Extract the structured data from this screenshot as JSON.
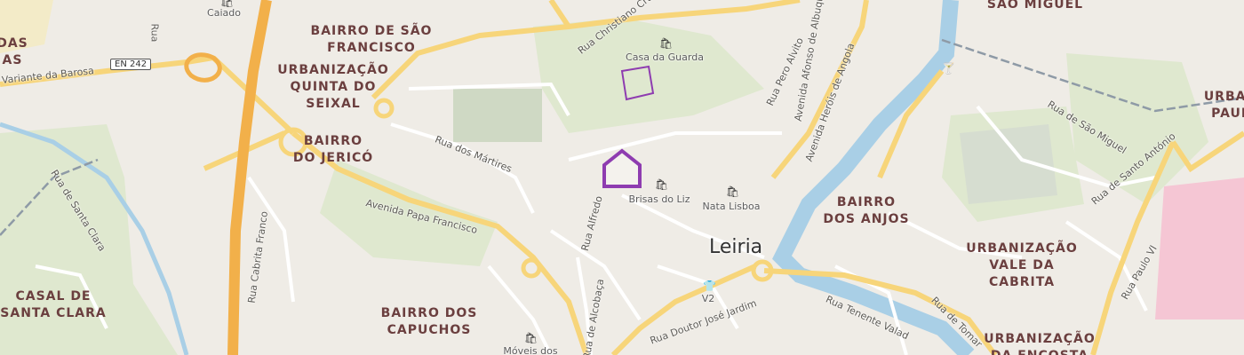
{
  "map": {
    "city": "Leiria",
    "road_shield": "EN 242",
    "districts": {
      "bairro_sao_francisco": [
        "BAIRRO DE SÃO",
        "FRANCISCO"
      ],
      "quinta_do_seixal": [
        "URBANIZAÇÃO",
        "QUINTA DO",
        "SEIXAL"
      ],
      "bairro_jerico": [
        "BAIRRO",
        "DO JERICÓ"
      ],
      "casal_santa_clara": [
        "CASAL DE",
        "SANTA CLARA"
      ],
      "bairro_capuchos": [
        "BAIRRO DOS",
        "CAPUCHOS"
      ],
      "bairro_anjos": [
        "BAIRRO",
        "DOS ANJOS"
      ],
      "vale_da_cabrita": [
        "URBANIZAÇÃO",
        "VALE DA",
        "CABRITA"
      ],
      "da_encosta": [
        "URBANIZAÇÃO",
        "DA ENCOSTA"
      ],
      "sao_miguel": [
        "SÃO MIGUEL"
      ],
      "urban_paulo": [
        "URBAN",
        "PAUL"
      ],
      "left_das": [
        "DAS",
        "AS"
      ]
    },
    "streets": {
      "variante_barosa": "Variante da Barosa",
      "christiano_cruz": "Rua Christiano Cruz",
      "martires": "Rua dos Mártires",
      "papa_francisco": "Avenida Papa Francisco",
      "cabrita_franco": "Rua Cabrita Franco",
      "santa_clara": "Rua de Santa Clara",
      "alfredo": "Rua Alfredo",
      "alcobaca": "Rua de Alcobaça",
      "doutor_jose_jardim": "Rua Doutor José Jardim",
      "tenente_valadim": "Rua Tenente Valad",
      "tomar": "Rua de Tomar",
      "paulo_vi": "Rua Paulo VI",
      "santo_antonio": "Rua de Santo António",
      "sao_miguel": "Rua de São Miguel",
      "herois_angola": "Avenida Heróis de Angola",
      "afonso_albuquerque": "Avenida Afonso de Albuquerque",
      "pero_alvito": "Rua Pero Alvito",
      "rua_partial": "Rua"
    },
    "pois": {
      "caiado": "Caiado",
      "casa_da_guarda": "Casa da Guarda",
      "brisas_do_liz": "Brisas do Liz",
      "nata_lisboa": "Nata Lisboa",
      "v2": "V2",
      "moveis": "Móveis dos"
    },
    "colors": {
      "background": "#efece6",
      "park": "#dfe8cf",
      "water": "#a9cfe6",
      "highway": "#f2b04a",
      "primary_road": "#f7d57a",
      "minor_road": "#ffffff",
      "district_label": "#6b3f3f",
      "marker": "#8e3cb0",
      "railway": "#8e9aa6",
      "hospital_area": "#f5c6d4"
    },
    "marker_icon": "home-icon",
    "shop_icon": "shopping-bag-icon",
    "tshirt_icon": "clothes-icon",
    "cocktail_icon": "cocktail-icon"
  }
}
